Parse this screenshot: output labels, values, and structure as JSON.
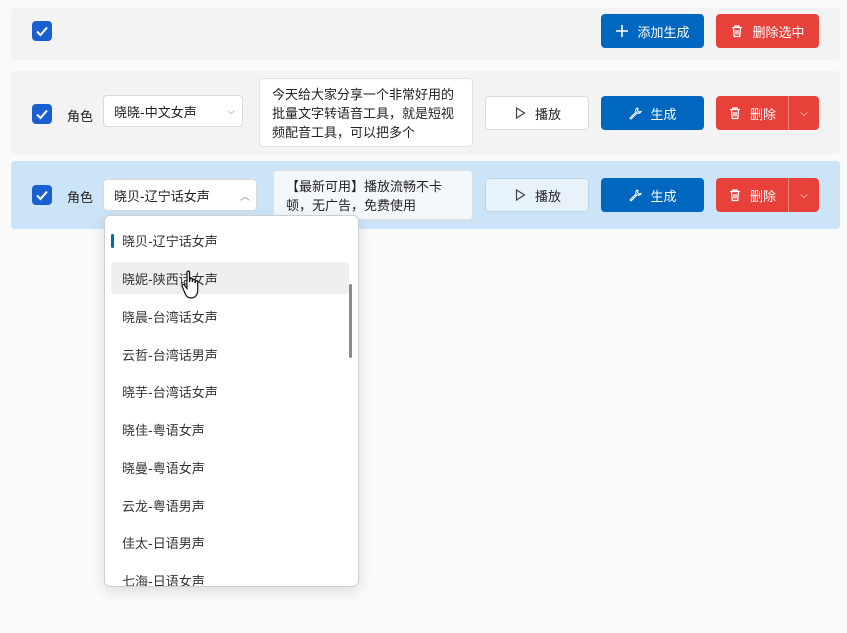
{
  "toolbar": {
    "add_label": "添加生成",
    "delete_selected_label": "删除选中"
  },
  "rows": [
    {
      "role_label": "角色",
      "voice": "晓晓-中文女声",
      "text": "今天给大家分享一个非常好用的批量文字转语音工具，就是短视频配音工具，可以把多个",
      "play_label": "播放",
      "generate_label": "生成",
      "delete_label": "删除"
    },
    {
      "role_label": "角色",
      "voice": "晓贝-辽宁话女声",
      "text": "【最新可用】播放流畅不卡顿，无广告，免费使用",
      "play_label": "播放",
      "generate_label": "生成",
      "delete_label": "删除"
    }
  ],
  "dropdown": {
    "options": [
      "晓贝-辽宁话女声",
      "晓妮-陕西话女声",
      "晓晨-台湾话女声",
      "云哲-台湾话男声",
      "晓芋-台湾话女声",
      "晓佳-粤语女声",
      "晓曼-粤语女声",
      "云龙-粤语男声",
      "佳太-日语男声",
      "七海-日语女声"
    ],
    "selected_index": 0,
    "hover_index": 1
  },
  "colors": {
    "primary": "#0067c0",
    "danger": "#e8413a",
    "checkbox": "#1a5fd0",
    "selected_row": "#cce4f7"
  }
}
